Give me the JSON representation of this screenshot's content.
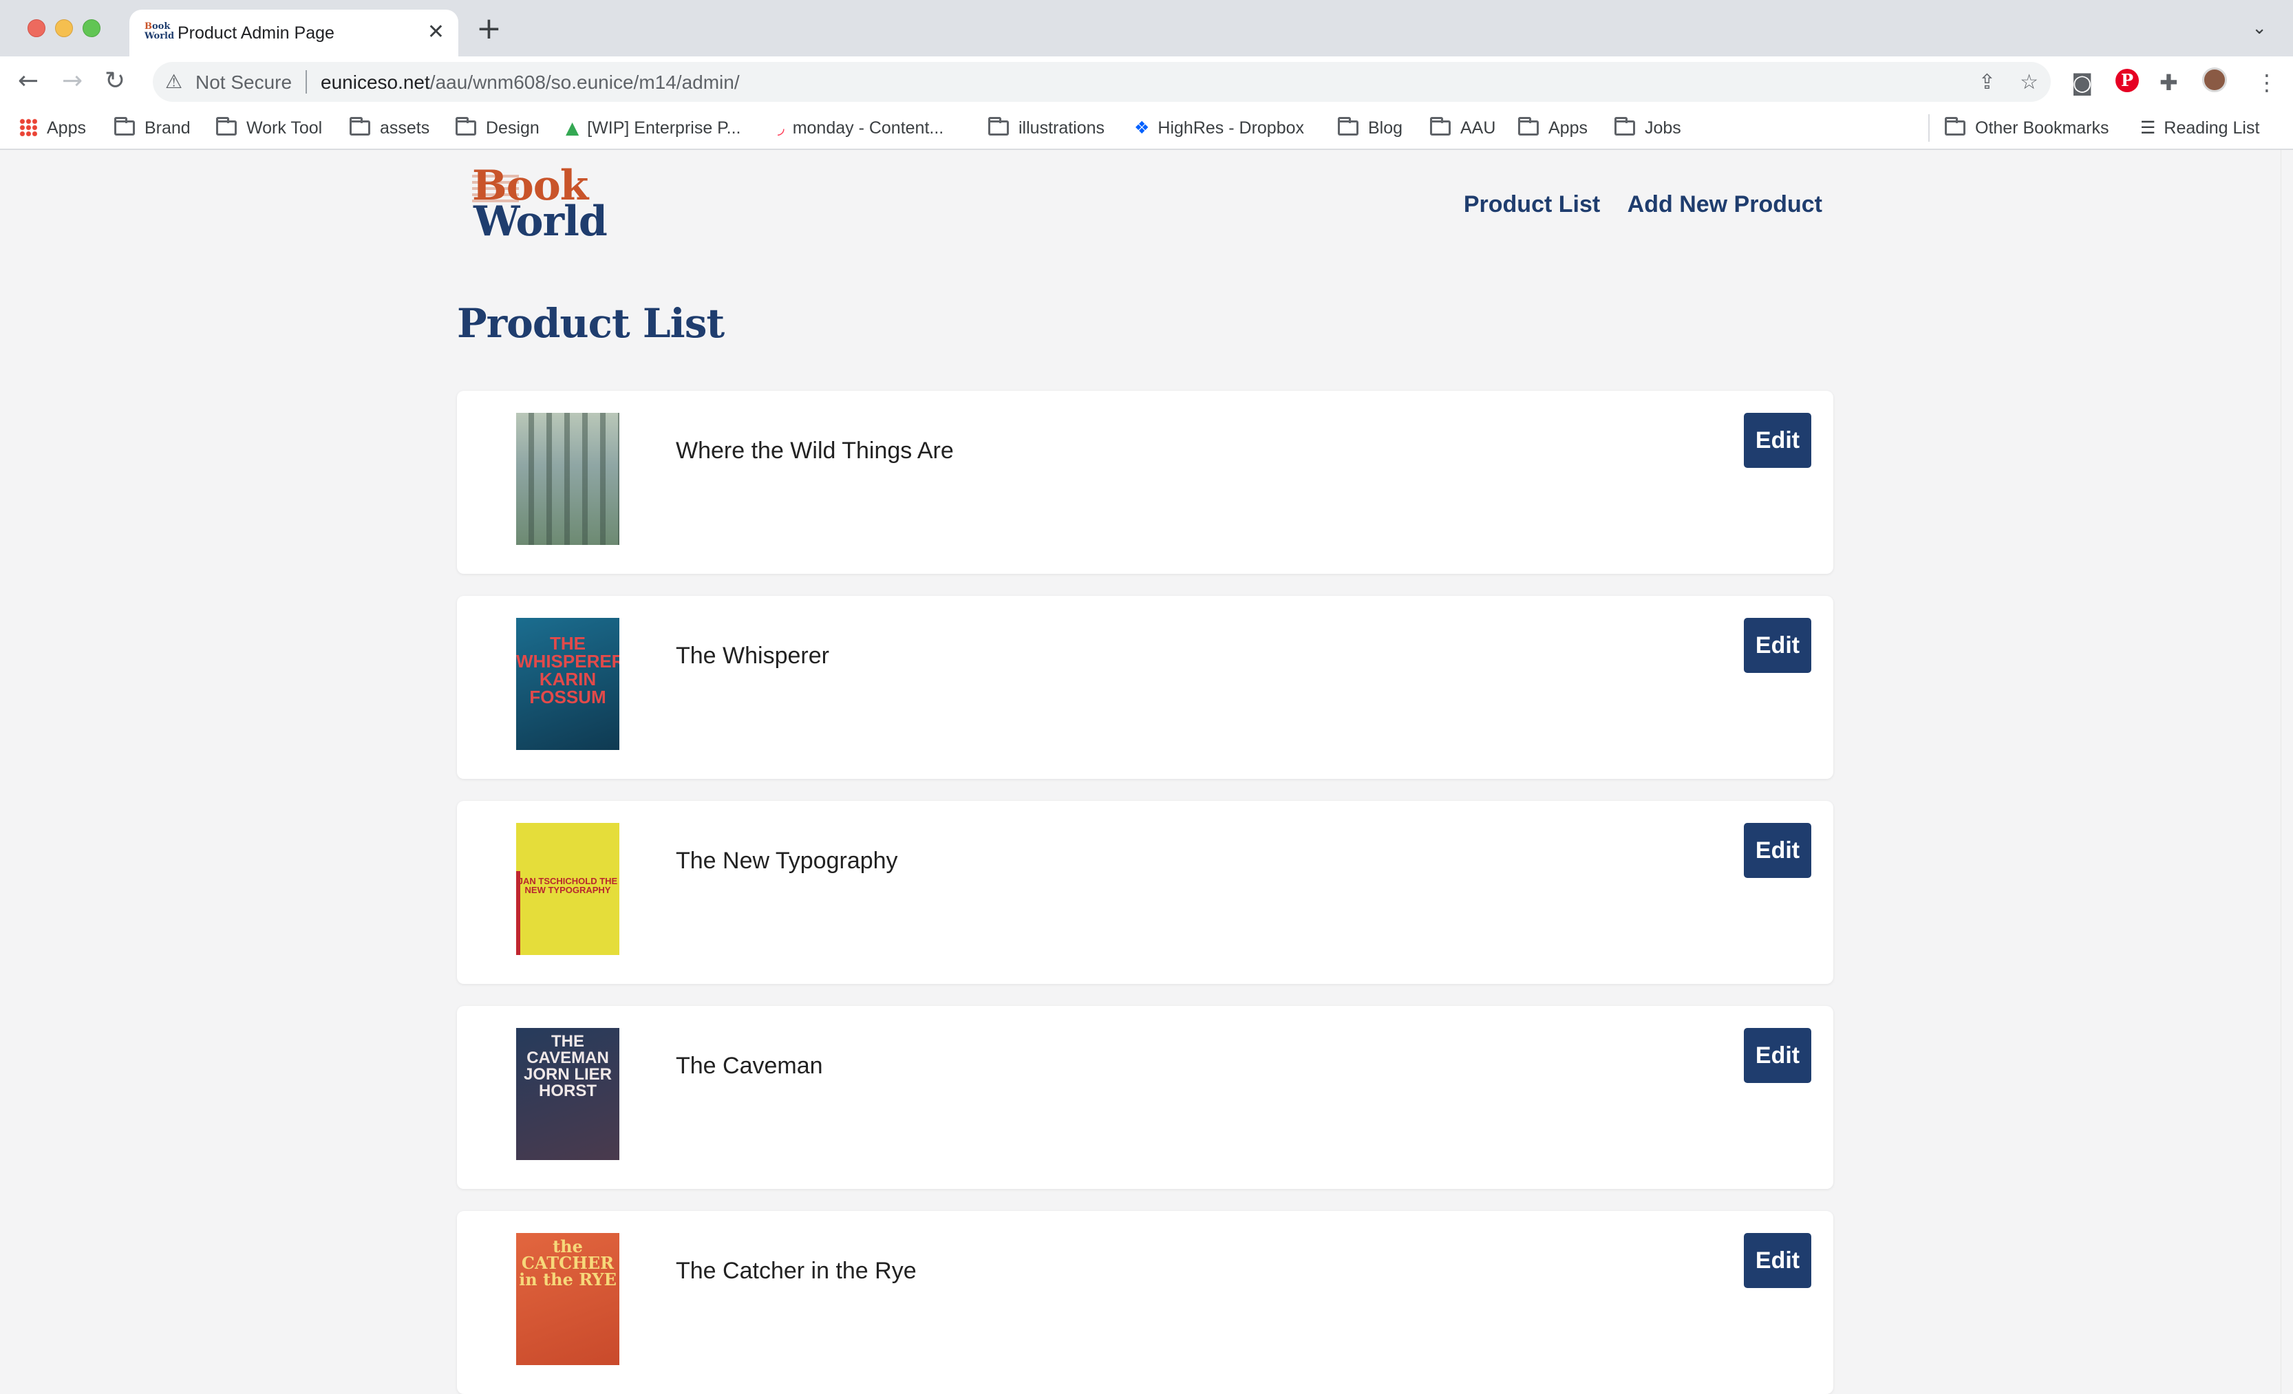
{
  "browser": {
    "tab_title": "Product Admin Page",
    "tab_favicon_text": "Book World",
    "new_tab_symbol": "+",
    "security_label": "Not Secure",
    "url_host": "euniceso.net",
    "url_path": "/aau/wnm608/so.eunice/m14/admin/",
    "bookmarks": [
      {
        "label": "Apps",
        "icon": "apps-grid-icon"
      },
      {
        "label": "Brand",
        "icon": "folder-icon"
      },
      {
        "label": "Work Tool",
        "icon": "folder-icon"
      },
      {
        "label": "assets",
        "icon": "folder-icon"
      },
      {
        "label": "Design",
        "icon": "folder-icon"
      },
      {
        "label": "[WIP] Enterprise P...",
        "icon": "google-drive-icon"
      },
      {
        "label": "monday - Content...",
        "icon": "monday-icon"
      },
      {
        "label": "illustrations",
        "icon": "folder-icon"
      },
      {
        "label": "HighRes - Dropbox",
        "icon": "dropbox-icon"
      },
      {
        "label": "Blog",
        "icon": "folder-icon"
      },
      {
        "label": "AAU",
        "icon": "folder-icon"
      },
      {
        "label": "Apps",
        "icon": "folder-icon"
      },
      {
        "label": "Jobs",
        "icon": "folder-icon"
      }
    ],
    "other_bookmarks": "Other Bookmarks",
    "reading_list": "Reading List"
  },
  "site": {
    "logo_line1": "Book",
    "logo_line2": "World",
    "nav": {
      "product_list": "Product List",
      "add_new_product": "Add New Product"
    },
    "page_title": "Product List",
    "products": [
      {
        "name": "Where the Wild Things Are",
        "edit_label": "Edit",
        "cover_colors": [
          "#8fa6a4",
          "#5f7a6b"
        ],
        "cover_text": ""
      },
      {
        "name": "The Whisperer",
        "edit_label": "Edit",
        "cover_colors": [
          "#1b6d8f",
          "#0f3a52"
        ],
        "cover_text": "THE WHISPERER KARIN FOSSUM"
      },
      {
        "name": "The New Typography",
        "edit_label": "Edit",
        "cover_colors": [
          "#e5dd3a",
          "#e5dd3a"
        ],
        "cover_text": "JAN TSCHICHOLD THE NEW TYPOGRAPHY"
      },
      {
        "name": "The Caveman",
        "edit_label": "Edit",
        "cover_colors": [
          "#263b5c",
          "#4a3a4d"
        ],
        "cover_text": "THE CAVEMAN JORN LIER HORST"
      },
      {
        "name": "The Catcher in the Rye",
        "edit_label": "Edit",
        "cover_colors": [
          "#e2663f",
          "#c94a2b"
        ],
        "cover_text": "the CATCHER in the RYE"
      }
    ]
  },
  "colors": {
    "brand_navy": "#1f3d6e",
    "brand_orange": "#c9542a",
    "page_bg": "#f4f4f5",
    "card_bg": "#ffffff"
  }
}
